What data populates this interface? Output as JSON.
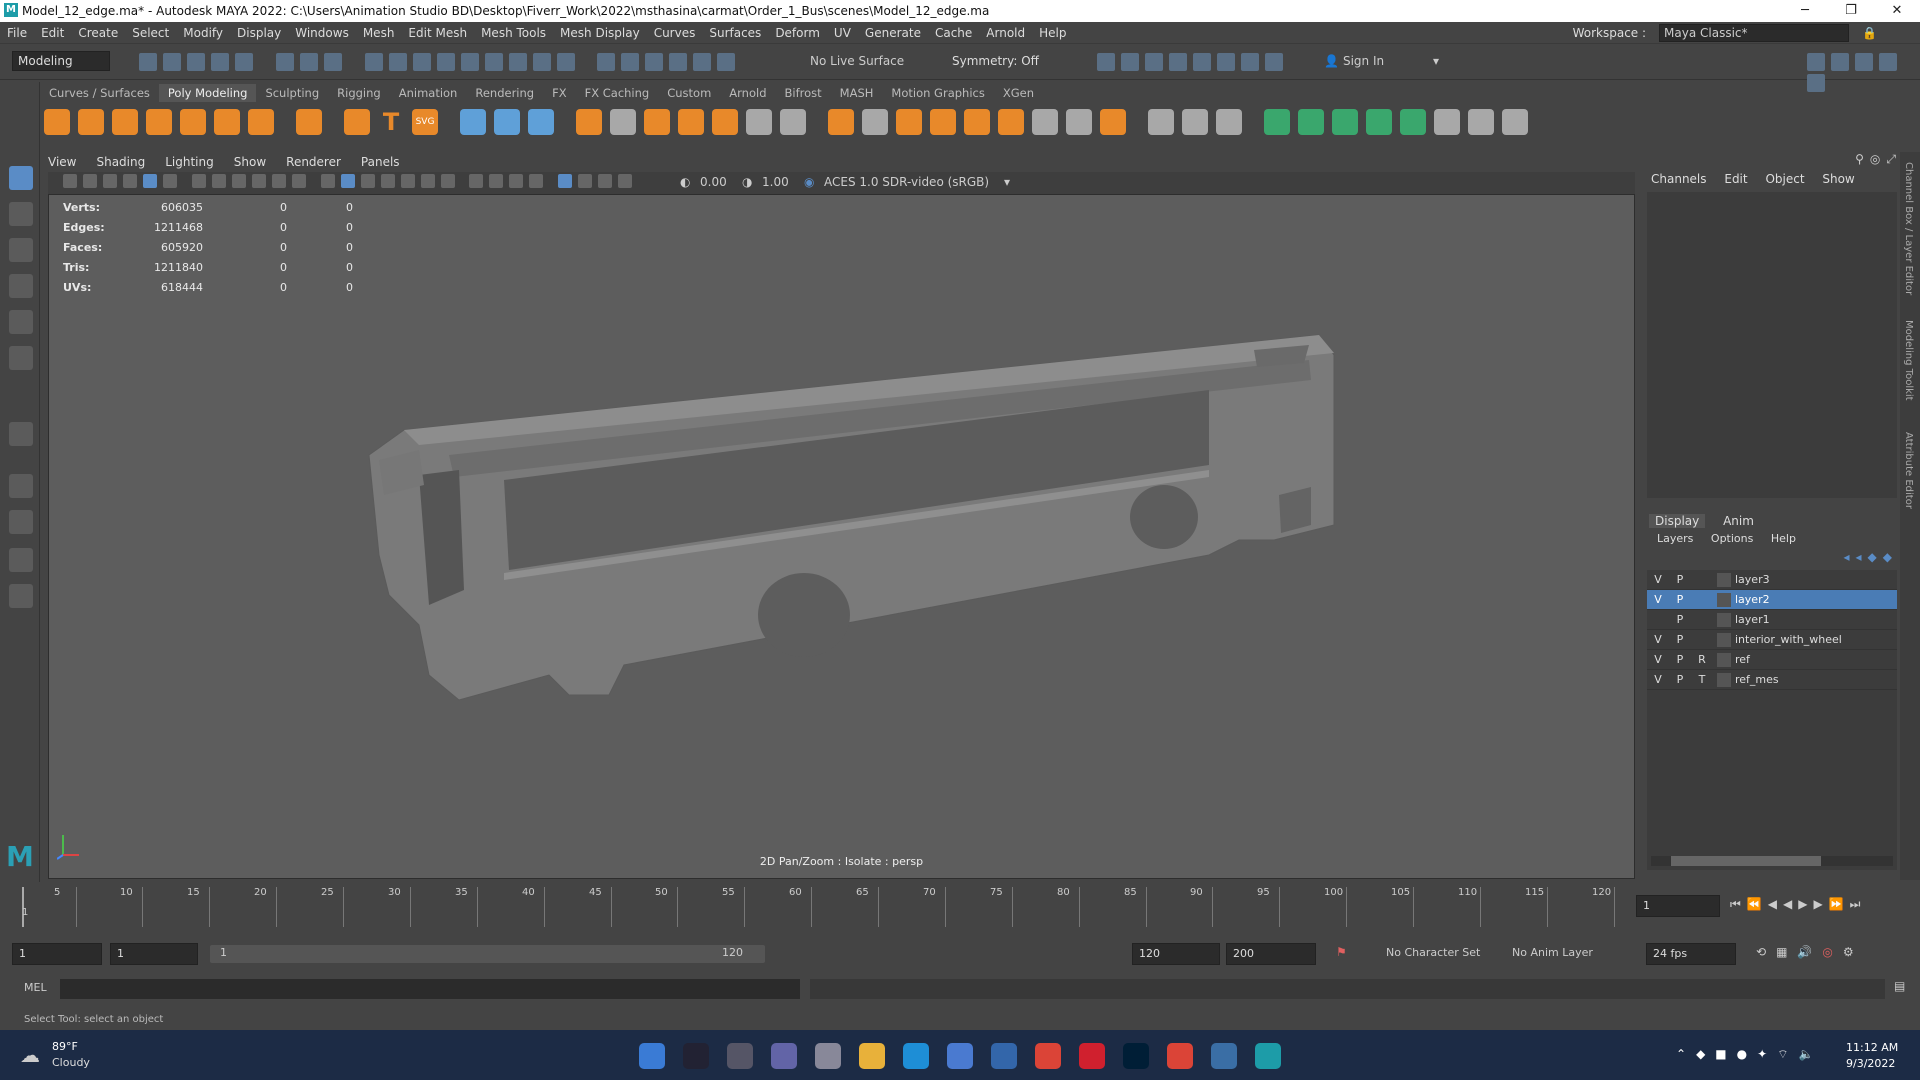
{
  "window": {
    "title": "Model_12_edge.ma* - Autodesk MAYA 2022: C:\\Users\\Animation Studio BD\\Desktop\\Fiverr_Work\\2022\\msthasina\\carmat\\Order_1_Bus\\scenes\\Model_12_edge.ma",
    "logo": "M"
  },
  "menubar": {
    "items": [
      "File",
      "Edit",
      "Create",
      "Select",
      "Modify",
      "Display",
      "Windows",
      "Mesh",
      "Edit Mesh",
      "Mesh Tools",
      "Mesh Display",
      "Curves",
      "Surfaces",
      "Deform",
      "UV",
      "Generate",
      "Cache",
      "Arnold",
      "Help"
    ],
    "workspace_label": "Workspace :",
    "workspace_value": "Maya Classic*"
  },
  "statusline": {
    "mode": "Modeling",
    "live_surface": "No Live Surface",
    "symmetry": "Symmetry: Off",
    "sign_in": "Sign In"
  },
  "shelf": {
    "tabs": [
      "Curves / Surfaces",
      "Poly Modeling",
      "Sculpting",
      "Rigging",
      "Animation",
      "Rendering",
      "FX",
      "FX Caching",
      "Custom",
      "Arnold",
      "Bifrost",
      "MASH",
      "Motion Graphics",
      "XGen"
    ],
    "active_tab": "Poly Modeling",
    "svg_label": "SVG"
  },
  "viewport": {
    "menu": [
      "View",
      "Shading",
      "Lighting",
      "Show",
      "Renderer",
      "Panels"
    ],
    "exposure": "0.00",
    "gamma": "1.00",
    "color_space": "ACES 1.0 SDR-video (sRGB)",
    "hud": [
      {
        "label": "Verts:",
        "v1": "606035",
        "v2": "0",
        "v3": "0"
      },
      {
        "label": "Edges:",
        "v1": "1211468",
        "v2": "0",
        "v3": "0"
      },
      {
        "label": "Faces:",
        "v1": "605920",
        "v2": "0",
        "v3": "0"
      },
      {
        "label": "Tris:",
        "v1": "1211840",
        "v2": "0",
        "v3": "0"
      },
      {
        "label": "UVs:",
        "v1": "618444",
        "v2": "0",
        "v3": "0"
      }
    ],
    "label": "2D Pan/Zoom : Isolate : persp"
  },
  "channelbox": {
    "tabs": [
      "Channels",
      "Edit",
      "Object",
      "Show"
    ]
  },
  "layer_editor": {
    "tabs": [
      "Display",
      "Anim"
    ],
    "menu": [
      "Layers",
      "Options",
      "Help"
    ],
    "layers": [
      {
        "v": "V",
        "p": "P",
        "t": "",
        "name": "layer3"
      },
      {
        "v": "V",
        "p": "P",
        "t": "",
        "name": "layer2"
      },
      {
        "v": "",
        "p": "P",
        "t": "",
        "name": "layer1"
      },
      {
        "v": "V",
        "p": "P",
        "t": "",
        "name": "interior_with_wheel"
      },
      {
        "v": "V",
        "p": "P",
        "t": "R",
        "name": "ref"
      },
      {
        "v": "V",
        "p": "P",
        "t": "T",
        "name": "ref_mes"
      }
    ],
    "selected_layer": "layer2"
  },
  "side_tabs": [
    "Channel Box / Layer Editor",
    "Modeling Toolkit",
    "Attribute Editor"
  ],
  "timeline": {
    "ticks": [
      "5",
      "10",
      "15",
      "20",
      "25",
      "30",
      "35",
      "40",
      "45",
      "50",
      "55",
      "60",
      "65",
      "70",
      "75",
      "80",
      "85",
      "90",
      "95",
      "100",
      "105",
      "110",
      "115",
      "120"
    ],
    "current_frame_label": "1",
    "current_frame": "1"
  },
  "range": {
    "start": "1",
    "playback_start": "1",
    "slider_start": "1",
    "slider_end": "120",
    "playback_end": "120",
    "end": "200",
    "character_set": "No Character Set",
    "anim_layer": "No Anim Layer",
    "fps": "24 fps"
  },
  "command": {
    "mel_label": "MEL",
    "help_text": "Select Tool: select an object"
  },
  "taskbar": {
    "temperature": "89°F",
    "weather": "Cloudy",
    "time": "11:12 AM",
    "date": "9/3/2022"
  },
  "colors": {
    "accent": "#4a7cb5",
    "viewport_bg": "#5d5d5d",
    "panel_bg": "#444444",
    "taskbar": "#1c2b45"
  }
}
